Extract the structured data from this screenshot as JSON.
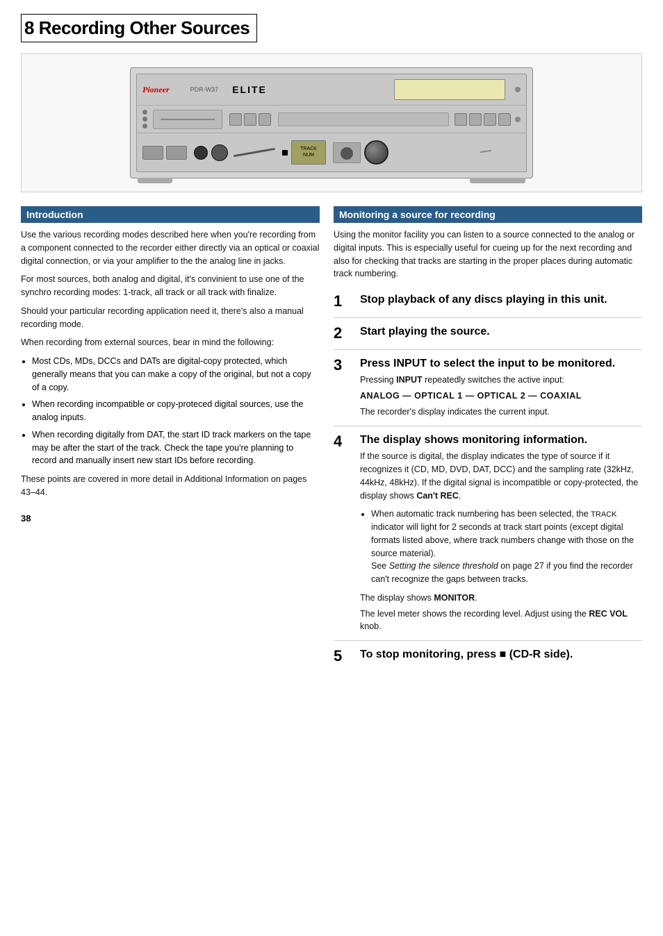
{
  "page": {
    "number": "8",
    "title": "Recording Other Sources",
    "page_num": "38"
  },
  "device": {
    "brand": "Pioneer",
    "model": "PDR-W37",
    "badge": "ELITE"
  },
  "intro": {
    "heading": "Introduction",
    "paragraphs": [
      "Use the various recording modes described here when you're recording from a component connected to the recorder either directly via an optical or coaxial digital connection, or via your amplifier to the the analog line in jacks.",
      "For most sources, both analog and digital, it's convinient to use one of the synchro recording modes: 1-track, all track or all track with finalize.",
      "Should your particular recording application need it, there's also a manual recording mode.",
      "When recording from external sources, bear in mind the following:"
    ],
    "bullets": [
      "Most CDs, MDs, DCCs and DATs are digital-copy protected, which generally means that you can make a copy of the original, but not a copy of a copy.",
      "When recording incompatible or copy-proteced digital sources, use the analog inputs.",
      "When recording digitally from DAT, the start ID track markers on the tape may be after the start of the track. Check the tape you're planning to record and manually insert new start IDs before recording."
    ],
    "footer": "These points are covered in more detail in Additional Information on pages 43–44."
  },
  "monitoring": {
    "heading": "Monitoring a source for recording",
    "intro": "Using the monitor facility you can listen to a source connected to the analog or digital inputs. This is especially useful for cueing up for the next recording and also for checking that tracks are starting in the proper places during automatic track numbering.",
    "steps": [
      {
        "number": "1",
        "title": "Stop playback of any discs playing in this unit.",
        "body": ""
      },
      {
        "number": "2",
        "title": "Start playing the source.",
        "body": ""
      },
      {
        "number": "3",
        "title": "Press INPUT to select the input to be monitored.",
        "body_prefix": "Pressing ",
        "body_input": "INPUT",
        "body_suffix": " repeatedly switches the active input:",
        "input_sequence": "ANALOG — OPTICAL 1 — OPTICAL 2 — COAXIAL",
        "body_footer": "The recorder's display indicates the current input."
      },
      {
        "number": "4",
        "title": "The display shows monitoring information.",
        "body_main": "If the source is digital, the display indicates the type of source if it recognizes it (CD, MD, DVD, DAT, DCC) and the sampling rate (32kHz, 44kHz, 48kHz). If the digital signal is incompatible or copy-protected, the display shows",
        "cant_rec": "Can't REC",
        "bullet": "When automatic track numbering has been selected, the TRACK indicator will light for 2 seconds at track start points (except digital formats listed above, where track numbers change with those on the source material). See Setting the silence threshold on page 27 if you find the recorder can't recognize the gaps between tracks.",
        "monitor_line": "The display shows MONITOR.",
        "rec_vol_line": "The level meter shows the recording level. Adjust using the REC VOL knob.",
        "silence_italic": "Setting the silence threshold",
        "monitor_bold": "MONITOR",
        "rec_vol_bold": "REC VOL"
      },
      {
        "number": "5",
        "title": "To stop monitoring, press ■ (CD-R side).",
        "body": ""
      }
    ]
  }
}
